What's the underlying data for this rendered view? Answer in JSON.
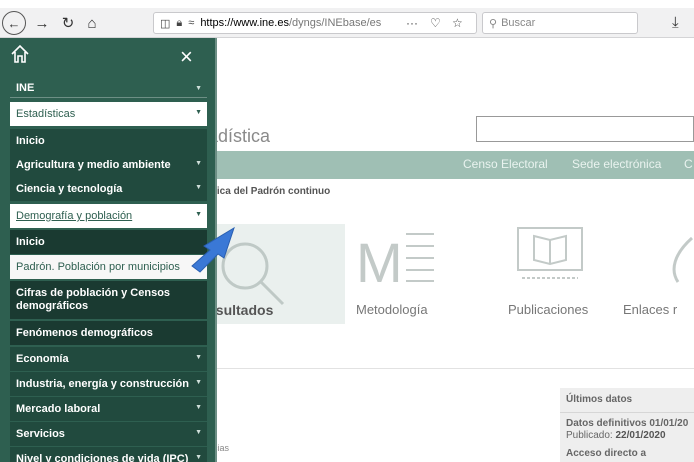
{
  "browser": {
    "url_host": "https://www.ine.es",
    "url_path": "/dyngs/INEbase/es",
    "more_icon": "···",
    "search_placeholder": "Buscar"
  },
  "page": {
    "site_title": "adística",
    "navbar_links": [
      "Censo Electoral",
      "Sede electrónica",
      "C"
    ],
    "breadcrumb": "stica del Padrón continuo",
    "tiles": [
      "esultados",
      "Metodología",
      "Publicaciones",
      "Enlaces r"
    ],
    "latest": {
      "heading": "Últimos datos",
      "definitive": "Datos definitivos 01/01/20",
      "published_label": "Publicado:",
      "published_date": "22/01/2020",
      "direct_access": "Acceso directo a"
    },
    "footer_fragment": "ncias"
  },
  "menu": {
    "close_symbol": "×",
    "ine": "INE",
    "estadisticas": "Estadísticas",
    "items": [
      {
        "label": "Inicio"
      },
      {
        "label": "Agricultura y medio ambiente"
      },
      {
        "label": "Ciencia y tecnología"
      },
      {
        "label": "Demografía y población"
      },
      {
        "label": "Inicio"
      },
      {
        "label": "Padrón. Población por municipios"
      },
      {
        "label": "Cifras de población y Censos demográficos"
      },
      {
        "label": "Fenómenos demográficos"
      },
      {
        "label": "Economía"
      },
      {
        "label": "Industria, energía y construcción"
      },
      {
        "label": "Mercado laboral"
      },
      {
        "label": "Servicios"
      },
      {
        "label": "Nivel y condiciones de vida (IPC)"
      }
    ]
  },
  "colors": {
    "menu_bg": "#2e5f50",
    "navbar_bg": "#9fbfb4",
    "arrow": "#3a78d6"
  },
  "icons": [
    "home-icon",
    "close-icon",
    "chevron-down-icon",
    "magnifier-icon",
    "methodology-icon",
    "publications-icon",
    "links-icon",
    "arrow-pointer"
  ]
}
